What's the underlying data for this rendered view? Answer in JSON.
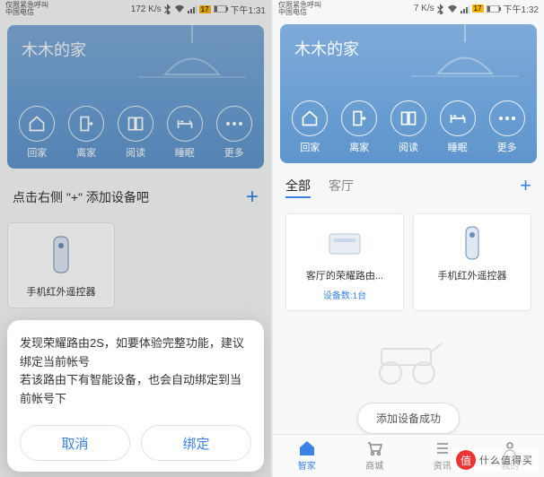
{
  "left": {
    "status": {
      "carrier1": "仅限紧急呼叫",
      "carrier2": "中国电信",
      "speed": "172 K/s",
      "battlabel": "17",
      "time": "下午1:31"
    },
    "hero_title": "木木的家",
    "scenes": [
      "回家",
      "离家",
      "阅读",
      "睡眠",
      "更多"
    ],
    "add_hint": "点击右侧 \"+\" 添加设备吧",
    "device": "手机红外遥控器",
    "prompt": {
      "line1": "发现荣耀路由2S，如要体验完整功能，建议绑定当前帐号",
      "line2": "若该路由下有智能设备，也会自动绑定到当前帐号下",
      "cancel": "取消",
      "confirm": "绑定"
    }
  },
  "right": {
    "status": {
      "carrier1": "仅限紧急呼叫",
      "carrier2": "中国电信",
      "speed": "7 K/s",
      "battlabel": "17",
      "time": "下午1:32"
    },
    "hero_title": "木木的家",
    "scenes": [
      "回家",
      "离家",
      "阅读",
      "睡眠",
      "更多"
    ],
    "tabs": {
      "all": "全部",
      "room": "客厅"
    },
    "dev1": {
      "name": "客厅的荣耀路由...",
      "sub": "设备数:1台"
    },
    "dev2": {
      "name": "手机红外遥控器"
    },
    "toast": "添加设备成功",
    "tabbar": [
      "智家",
      "商城",
      "资讯",
      "我的"
    ]
  },
  "watermark": "什么值得买"
}
